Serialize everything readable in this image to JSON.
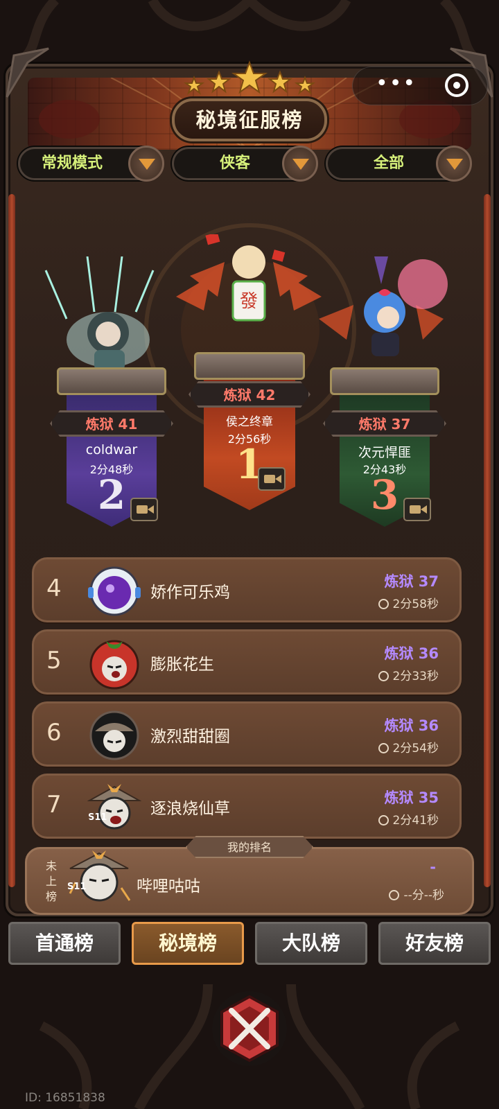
{
  "top_bar": {
    "more_icon": "dots-icon",
    "target_icon": "target-icon"
  },
  "banner": {
    "title": "秘境征服榜",
    "star_count": 5
  },
  "filters": [
    {
      "label": "常规模式",
      "arrow_icon": "chevron-down-icon"
    },
    {
      "label": "侠客",
      "arrow_icon": "chevron-down-icon"
    },
    {
      "label": "全部",
      "arrow_icon": "chevron-down-icon"
    }
  ],
  "podium": {
    "first": {
      "rank": "1",
      "level": "炼狱 42",
      "name": "侯之终章",
      "time": "2分56秒"
    },
    "second": {
      "rank": "2",
      "level": "炼狱 41",
      "name": "coldwar",
      "time": "2分48秒"
    },
    "third": {
      "rank": "3",
      "level": "炼狱 37",
      "name": "次元悍匪",
      "time": "2分43秒"
    }
  },
  "rankings": [
    {
      "rank": "4",
      "name": "娇作可乐鸡",
      "level": "炼狱 37",
      "time": "2分58秒"
    },
    {
      "rank": "5",
      "name": "膨胀花生",
      "level": "炼狱 36",
      "time": "2分33秒"
    },
    {
      "rank": "6",
      "name": "激烈甜甜圈",
      "level": "炼狱 36",
      "time": "2分54秒"
    },
    {
      "rank": "7",
      "name": "逐浪烧仙草",
      "level": "炼狱 35",
      "time": "2分41秒"
    }
  ],
  "my_rank": {
    "tag": "我的排名",
    "rank_line1": "未",
    "rank_line2": "上",
    "rank_line3": "榜",
    "name": "哔哩咕咕",
    "level": "-",
    "time": "--分--秒",
    "season_badge": "S11"
  },
  "season_badge": "S11",
  "tabs": [
    {
      "label": "首通榜",
      "active": false
    },
    {
      "label": "秘境榜",
      "active": true
    },
    {
      "label": "大队榜",
      "active": false
    },
    {
      "label": "好友榜",
      "active": false
    }
  ],
  "footer": {
    "id_text": "ID: 16851838"
  },
  "colors": {
    "level_purple": "#b48aff",
    "level_red": "#ff7a6a",
    "filter_text": "#d6f07a",
    "tab_active_border": "#e89a4a"
  }
}
